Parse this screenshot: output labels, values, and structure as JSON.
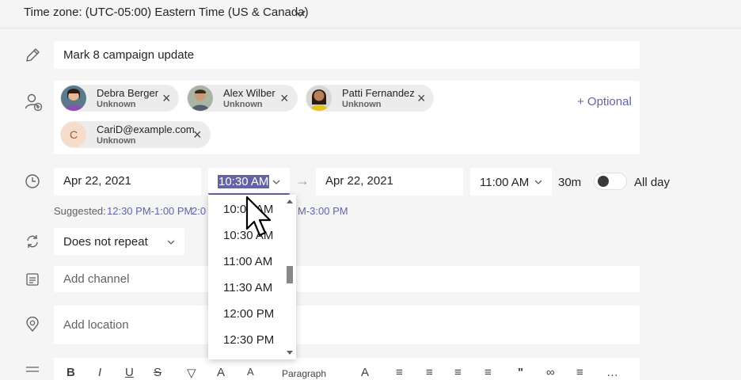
{
  "timezone": {
    "label": "Time zone: (UTC-05:00) Eastern Time (US & Canada)"
  },
  "title_field": {
    "value": "Mark 8 campaign update"
  },
  "attendees": [
    {
      "name": "Debra Berger",
      "status": "Unknown"
    },
    {
      "name": "Alex Wilber",
      "status": "Unknown"
    },
    {
      "name": "Patti Fernandez",
      "status": "Unknown"
    },
    {
      "name": "CariD@example.com",
      "status": "Unknown",
      "initial": "C"
    }
  ],
  "optional_label": "+ Optional",
  "schedule": {
    "start_date": "Apr 22, 2021",
    "start_time": "10:30 AM",
    "arrow": "→",
    "end_date": "Apr 22, 2021",
    "end_time": "11:00 AM",
    "duration": "30m",
    "all_day_label": "All day",
    "all_day_on": false
  },
  "suggested": {
    "label": "Suggested:",
    "slots": [
      "12:30 PM-1:00 PM",
      "2:0",
      "M-3:00 PM"
    ]
  },
  "time_options": [
    "10:00 AM",
    "10:30 AM",
    "11:00 AM",
    "11:30 AM",
    "12:00 PM",
    "12:30 PM"
  ],
  "repeat": {
    "value": "Does not repeat"
  },
  "channel": {
    "placeholder": "Add channel"
  },
  "location": {
    "placeholder": "Add location"
  },
  "toolbar": {
    "bold": "B",
    "italic": "I",
    "underline": "U",
    "strike": "S",
    "paragraph": "Paragraph"
  },
  "colors": {
    "accent": "#6264a7",
    "selection": "#6264a7",
    "background": "#f5f5f5",
    "field": "#ffffff"
  },
  "icons": {
    "timezone": "chevron-down-icon",
    "title": "pencil-icon",
    "attendees": "add-person-icon",
    "time": "clock-icon",
    "repeat": "repeat-icon",
    "channel": "channel-icon",
    "location": "location-icon",
    "details": "details-icon"
  }
}
